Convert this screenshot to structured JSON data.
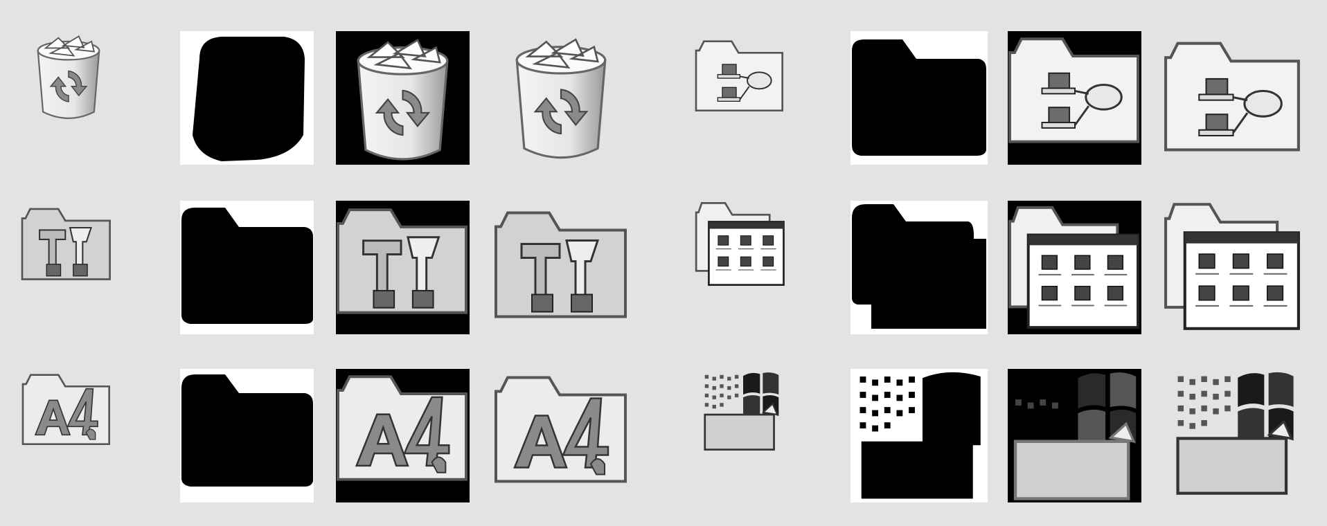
{
  "sheet": {
    "background": "#e3e3e3",
    "icons": [
      {
        "name": "recycle-bin-icon",
        "kind": "recycle"
      },
      {
        "name": "network-folder-icon",
        "kind": "network"
      },
      {
        "name": "tools-folder-icon",
        "kind": "tools"
      },
      {
        "name": "programs-folder-icon",
        "kind": "programs"
      },
      {
        "name": "fonts-folder-icon",
        "kind": "fonts"
      },
      {
        "name": "windows-folder-icon",
        "kind": "windows"
      }
    ],
    "variants": [
      "small-icon",
      "mask",
      "inverted-background",
      "large-icon"
    ],
    "colors": {
      "mask_bg": "#ffffff",
      "mask_fg": "#000000",
      "icon_face": "#d6d6d6",
      "icon_light": "#f6f6f6",
      "icon_dark": "#555555"
    }
  }
}
